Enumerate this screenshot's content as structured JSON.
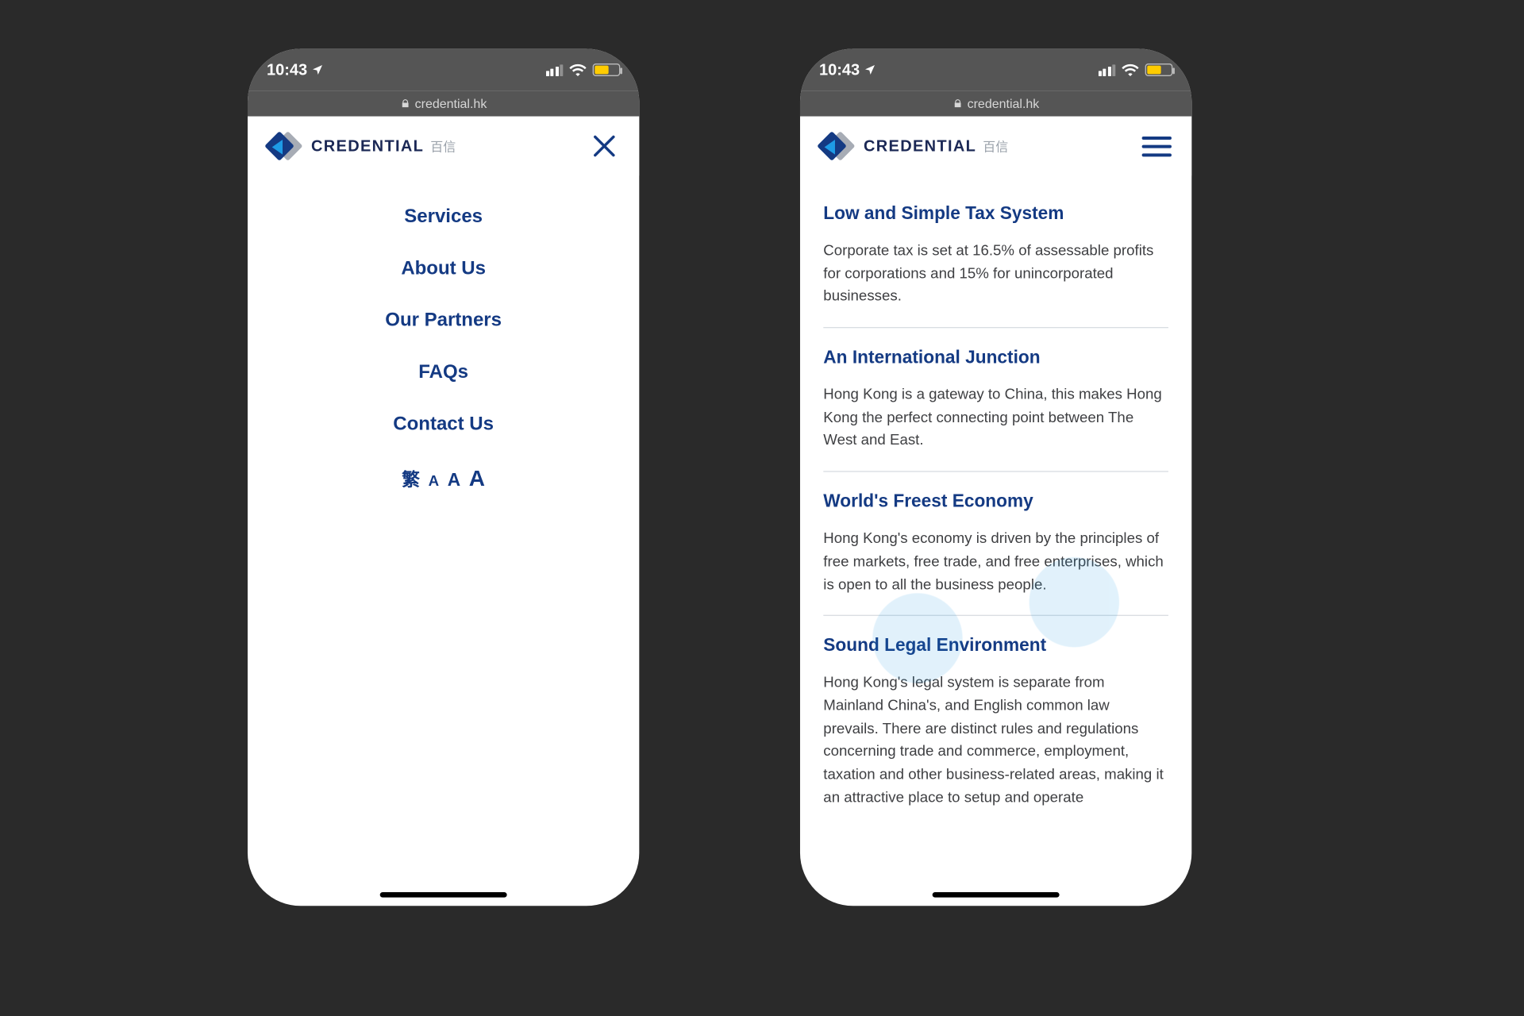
{
  "status": {
    "time": "10:43"
  },
  "url": {
    "host": "credential.hk"
  },
  "brand": {
    "name": "CREDENTIAL",
    "sub": "百信"
  },
  "menu": {
    "items": [
      {
        "label": "Services"
      },
      {
        "label": "About Us"
      },
      {
        "label": "Our Partners"
      },
      {
        "label": "FAQs"
      },
      {
        "label": "Contact Us"
      }
    ],
    "lang": {
      "zh": "繁",
      "a1": "A",
      "a2": "A",
      "a3": "A"
    }
  },
  "sections": [
    {
      "title": "Low and Simple Tax System",
      "body": "Corporate tax is set at 16.5% of assessable profits for corporations and 15% for unincorporated businesses."
    },
    {
      "title": "An International Junction",
      "body": "Hong Kong is a gateway to China, this makes Hong Kong the perfect connecting point between The West and East."
    },
    {
      "title": "World's Freest Economy",
      "body": "Hong Kong's economy is driven by the principles of free markets, free trade, and free enterprises, which is open to all the business people."
    },
    {
      "title": "Sound Legal Environment",
      "body": "Hong Kong's legal system is separate from Mainland China's, and English common law prevails. There are distinct rules and regulations concerning trade and commerce, employment, taxation and other business-related areas, making it an attractive place to setup and operate"
    }
  ]
}
